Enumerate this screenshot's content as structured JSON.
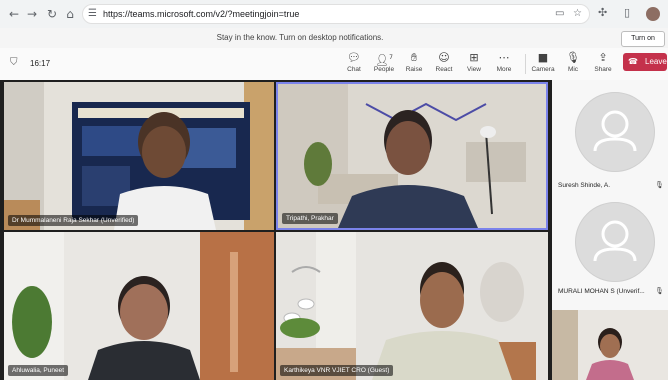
{
  "browser": {
    "url": "https://teams.microsoft.com/v2/?meetingjoin=true",
    "nav_icons": {
      "back": "back-arrow-icon",
      "forward": "forward-arrow-icon",
      "reload": "reload-icon",
      "home": "home-icon"
    }
  },
  "notification": {
    "text": "Stay in the know. Turn on desktop notifications.",
    "button": "Turn on"
  },
  "toolbar": {
    "timer": "16:17",
    "items": [
      {
        "label": "Chat",
        "icon": "chat-icon"
      },
      {
        "label": "People",
        "icon": "people-icon",
        "badge": "7"
      },
      {
        "label": "Raise",
        "icon": "raise-hand-icon"
      },
      {
        "label": "React",
        "icon": "react-icon"
      },
      {
        "label": "View",
        "icon": "view-icon"
      },
      {
        "label": "More",
        "icon": "more-icon"
      },
      {
        "label": "Camera",
        "icon": "camera-icon"
      },
      {
        "label": "Mic",
        "icon": "mic-off-icon"
      },
      {
        "label": "Share",
        "icon": "share-icon"
      }
    ],
    "leave": "Leave"
  },
  "participants": {
    "tiles": [
      {
        "name": "Dr Mummalaneni Raja Sekhar (Unverified)"
      },
      {
        "name": "Tripathi, Prakhar"
      },
      {
        "name": "Ahluwalia, Puneet"
      },
      {
        "name": "Karthikeya VNR VJIET CRO (Guest)"
      }
    ],
    "right_panel": [
      {
        "name": "Suresh Shinde, A."
      },
      {
        "name": "MURALI MOHAN S (Unverif..."
      }
    ]
  },
  "colors": {
    "leave": "#c4314b",
    "active_border": "#7b83eb"
  }
}
